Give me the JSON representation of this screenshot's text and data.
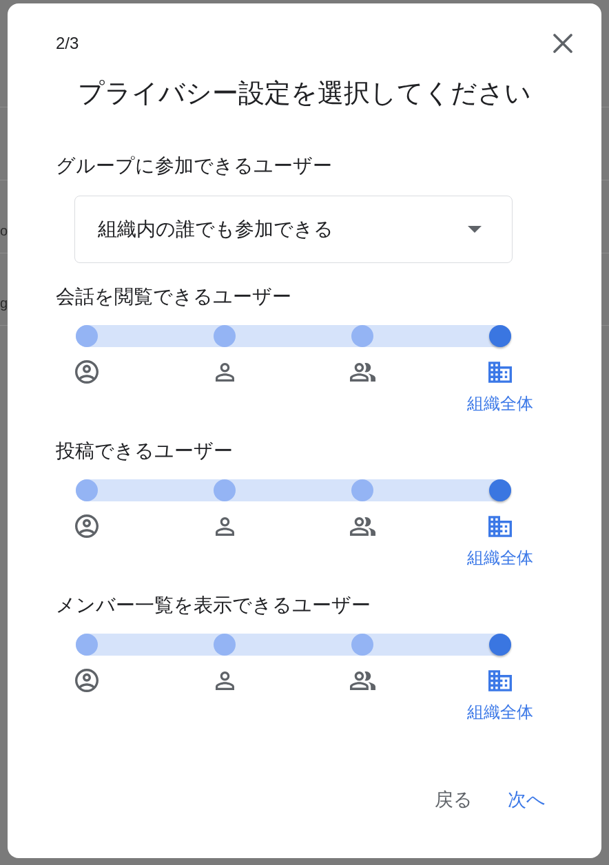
{
  "background_page": {
    "rows": [
      {
        "text": "o"
      },
      {
        "text": "g"
      }
    ]
  },
  "dialog": {
    "step": "2/3",
    "title": "プライバシー設定を選択してください",
    "join": {
      "label": "グループに参加できるユーザー",
      "value": "組織内の誰でも参加できる"
    },
    "sliders": [
      {
        "label": "会話を閲覧できるユーザー",
        "options": [
          {
            "kind": "account",
            "selected": false
          },
          {
            "kind": "person",
            "selected": false
          },
          {
            "kind": "group",
            "selected": false
          },
          {
            "kind": "building",
            "selected": true,
            "label": "組織全体"
          }
        ]
      },
      {
        "label": "投稿できるユーザー",
        "options": [
          {
            "kind": "account",
            "selected": false
          },
          {
            "kind": "person",
            "selected": false
          },
          {
            "kind": "group",
            "selected": false
          },
          {
            "kind": "building",
            "selected": true,
            "label": "組織全体"
          }
        ]
      },
      {
        "label": "メンバー一覧を表示できるユーザー",
        "options": [
          {
            "kind": "account",
            "selected": false
          },
          {
            "kind": "person",
            "selected": false
          },
          {
            "kind": "group",
            "selected": false
          },
          {
            "kind": "building",
            "selected": true,
            "label": "組織全体"
          }
        ]
      }
    ],
    "buttons": [
      {
        "label": "戻る",
        "kind": "secondary"
      },
      {
        "label": "次へ",
        "kind": "primary"
      }
    ]
  }
}
